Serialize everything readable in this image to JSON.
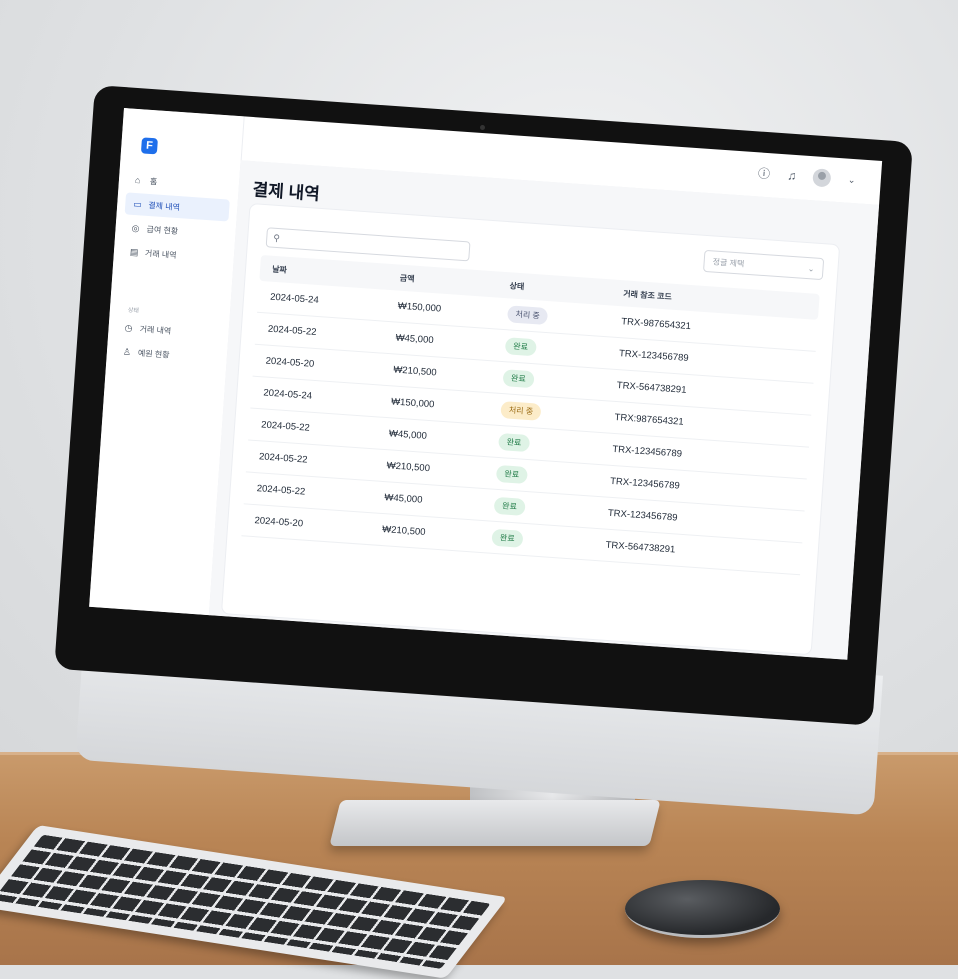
{
  "topbar": {
    "help_icon": "help-circle-icon",
    "bell_icon": "bell-icon",
    "avatar_icon": "user-avatar-icon",
    "chevron_icon": "chevron-down-icon"
  },
  "sidebar": {
    "logo_glyph": "F",
    "section_label": "상태",
    "items": [
      {
        "label": "홈",
        "icon": "home-icon"
      },
      {
        "label": "결제 내역",
        "icon": "card-icon"
      },
      {
        "label": "급여 현황",
        "icon": "money-icon"
      },
      {
        "label": "거래 내역",
        "icon": "list-icon"
      },
      {
        "label": "거래 내역",
        "icon": "clock-icon"
      },
      {
        "label": "예원 현황",
        "icon": "user-icon"
      }
    ]
  },
  "main": {
    "title": "결제 내역",
    "search": {
      "icon": "search-icon",
      "placeholder": ""
    },
    "filter": {
      "label": "정글 제택",
      "icon": "chevron-down-icon"
    },
    "table": {
      "columns": [
        "날짜",
        "금액",
        "상태",
        "거래 참조 코드"
      ],
      "rows": [
        {
          "date": "2024-05-24",
          "amount": "₩150,000",
          "status": "처리 중",
          "status_type": "proc",
          "code": "TRX-987654321"
        },
        {
          "date": "2024-05-22",
          "amount": "₩45,000",
          "status": "완료",
          "status_type": "done",
          "code": "TRX-123456789"
        },
        {
          "date": "2024-05-20",
          "amount": "₩210,500",
          "status": "완료",
          "status_type": "done",
          "code": "TRX-564738291"
        },
        {
          "date": "2024-05-24",
          "amount": "₩150,000",
          "status": "처리 중",
          "status_type": "proc2",
          "code": "TRX:987654321"
        },
        {
          "date": "2024-05-22",
          "amount": "₩45,000",
          "status": "완료",
          "status_type": "done",
          "code": "TRX-123456789"
        },
        {
          "date": "2024-05-22",
          "amount": "₩210,500",
          "status": "완료",
          "status_type": "done",
          "code": "TRX-123456789"
        },
        {
          "date": "2024-05-22",
          "amount": "₩45,000",
          "status": "완료",
          "status_type": "done",
          "code": "TRX-123456789"
        },
        {
          "date": "2024-05-20",
          "amount": "₩210,500",
          "status": "완료",
          "status_type": "done",
          "code": "TRX-564738291"
        }
      ]
    }
  },
  "colors": {
    "accent": "#1f6feb",
    "done_badge": "#dff3e6",
    "processing_badge": "#e7e9f2",
    "processing_badge_alt": "#fcecc9"
  }
}
